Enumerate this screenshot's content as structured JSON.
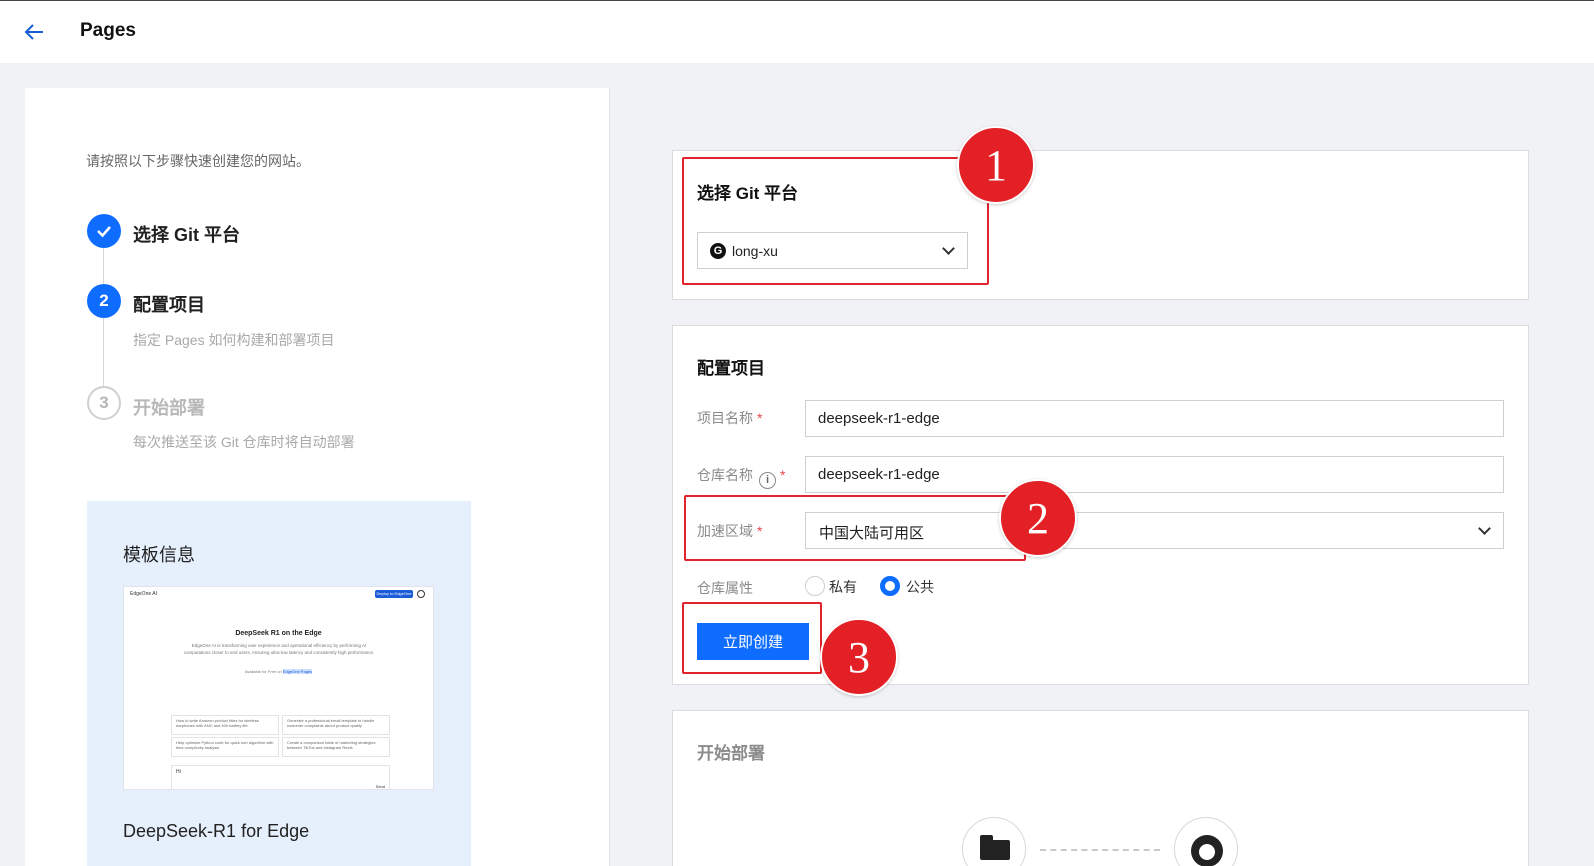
{
  "header": {
    "title": "Pages",
    "back_icon": "arrow-left-icon"
  },
  "intro": "请按照以下步骤快速创建您的网站。",
  "steps": [
    {
      "number": "✓",
      "title": "选择 Git 平台",
      "desc": "",
      "status": "done"
    },
    {
      "number": "2",
      "title": "配置项目",
      "desc": "指定 Pages 如何构建和部署项目",
      "status": "active"
    },
    {
      "number": "3",
      "title": "开始部署",
      "desc": "每次推送至该 Git 仓库时将自动部署",
      "status": "pending"
    }
  ],
  "template": {
    "heading": "模板信息",
    "name": "DeepSeek-R1 for Edge",
    "preview": {
      "brand": "EdgeOne AI",
      "button": "Deploy to EdgeOne",
      "title": "DeepSeek R1 on the Edge",
      "desc": "EdgeOne AI is transforming user experience and operational efficiency by performing AI computations closer to end users, ensuring ultra-low latency and consistently high performance.",
      "avail_prefix": "Available for Free on",
      "avail_link": "EdgeOne Pages",
      "cards": [
        "How to write Amazon product titles for wireless earphones with ANC and 40h battery life",
        "Generate a professional email template to handle customer complaints about product quality",
        "Help optimize Python code for quick sort algorithm with time complexity analysis",
        "Create a comparison table of marketing strategies between TikTok and Instagram Reels"
      ],
      "input": "Hi",
      "send": "Send"
    }
  },
  "git_card": {
    "title": "选择 Git 平台",
    "selected_account": "long-xu",
    "logo_letter": "G"
  },
  "config_card": {
    "title": "配置项目",
    "project_name_label": "项目名称",
    "project_name_value": "deepseek-r1-edge",
    "repo_name_label": "仓库名称",
    "repo_name_value": "deepseek-r1-edge",
    "region_label": "加速区域",
    "region_value": "中国大陆可用区",
    "visibility_label": "仓库属性",
    "visibility_options": [
      "私有",
      "公共"
    ],
    "visibility_selected": "公共",
    "create_button": "立即创建",
    "required_mark": "*",
    "info_glyph": "i"
  },
  "deploy_card": {
    "title": "开始部署"
  },
  "annotations": [
    "1",
    "2",
    "3"
  ],
  "colors": {
    "primary": "#0e6cff",
    "annotation_red": "#e32025"
  }
}
